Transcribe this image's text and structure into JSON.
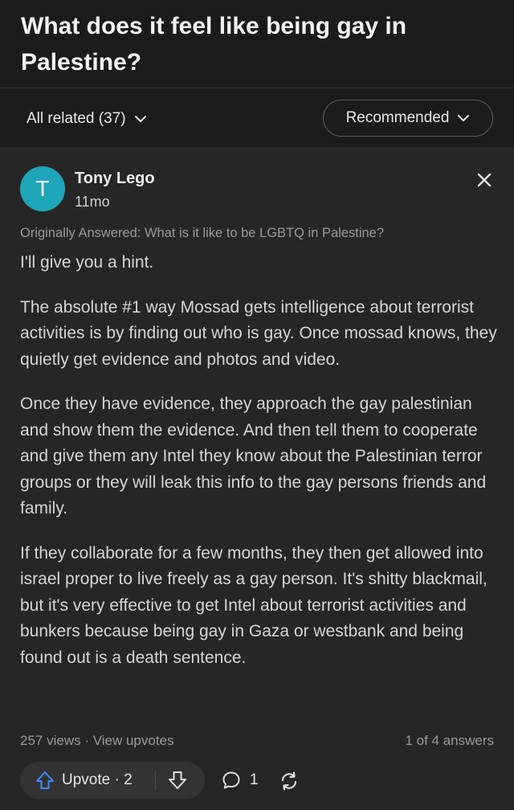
{
  "question": {
    "title": "What does it feel like being gay in Palestine?"
  },
  "filters": {
    "related_label": "All related (37)",
    "sort_label": "Recommended"
  },
  "answer": {
    "avatar_letter": "T",
    "author_name": "Tony Lego",
    "age": "11mo",
    "original_question": "Originally Answered: What is it like to be LGBTQ in Palestine?",
    "paragraphs": [
      "I'll give you a hint.",
      "The absolute #1 way Mossad gets intelligence about terrorist activities is by finding out who is gay. Once mossad knows, they quietly get evidence and photos and video.",
      "Once they have evidence, they approach the gay palestinian and show them the evidence. And then tell them to cooperate and give them any Intel they know about the Palestinian terror groups or they will leak this info to the gay persons friends and family.",
      "If they collaborate for a few months, they then get allowed into israel proper to live freely as a gay person. It's shitty blackmail, but it's very effective to get Intel about terrorist activities and bunkers because being gay in Gaza or westbank and being found out is a death sentence."
    ],
    "views": "257 views · View upvotes",
    "answer_position": "1 of 4 answers",
    "upvote_label": "Upvote · 2",
    "comment_count": "1"
  },
  "colors": {
    "background": "#1b1b1b",
    "card": "#262626",
    "avatar": "#1fa5b8",
    "upvote_icon": "#3d8bff"
  },
  "icons": [
    "chevron-down-icon",
    "close-icon",
    "upvote-arrow-icon",
    "downvote-arrow-icon",
    "comment-icon",
    "share-icon"
  ]
}
